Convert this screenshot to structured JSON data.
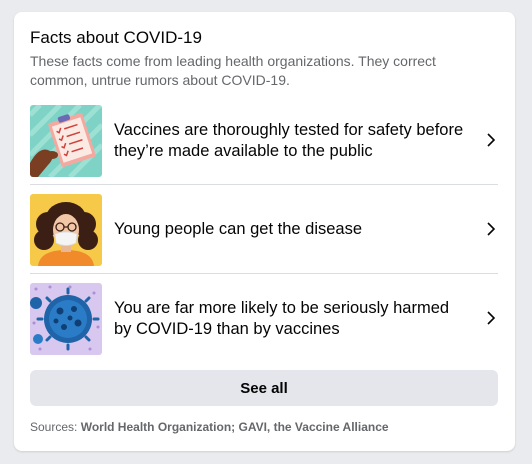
{
  "card": {
    "title": "Facts about COVID-19",
    "subtitle": "These facts come from leading health organizations. They correct common, untrue rumors about COVID-19."
  },
  "items": [
    {
      "text": "Vaccines are thoroughly tested for safety before they’re made available to the public",
      "icon": "clipboard-checklist-image"
    },
    {
      "text": "Young people can get the disease",
      "icon": "young-person-masked-image"
    },
    {
      "text": "You are far more likely to be seriously harmed by COVID-19 than by vaccines",
      "icon": "virus-particles-image"
    }
  ],
  "see_all": {
    "label": "See all"
  },
  "sources": {
    "prefix": "Sources:",
    "names": "World Health Organization; GAVI, the Vaccine Alliance"
  },
  "colors": {
    "background": "#e9ebee",
    "card": "#ffffff",
    "button": "#e4e6eb",
    "secondary_text": "#65676b"
  }
}
